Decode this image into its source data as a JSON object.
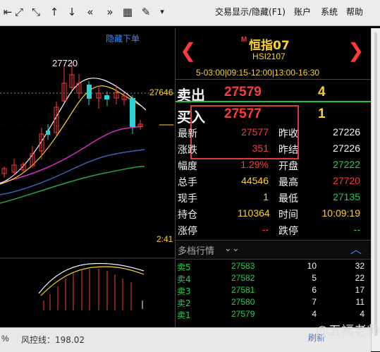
{
  "toolbar": {
    "icons": [
      "arrow-left-icon",
      "resize-icon",
      "shrink-icon",
      "up-arrow-icon",
      "down-arrow-icon",
      "double-left-icon",
      "double-right-icon",
      "grid-icon",
      "pen-icon",
      "dropdown-icon"
    ],
    "menus": [
      "交易显示/隐藏(F1)",
      "账户",
      "系统",
      "帮助"
    ]
  },
  "chart": {
    "hide_order_label": "隐藏下单",
    "high_label": "27720",
    "price_label": "27646",
    "time_label": "2:41"
  },
  "symbol": {
    "badge": "M",
    "name": "恒指07",
    "code": "HSI2107",
    "session": "5-03:00|09:15-12:00|13:00-16:30"
  },
  "order_book": {
    "ask_label": "卖出",
    "ask_price": "27579",
    "ask_volume": "4",
    "bid_label": "买入",
    "bid_price": "27577",
    "bid_volume": "1"
  },
  "quote": {
    "rows": [
      {
        "l1": "最新",
        "v1": "27577",
        "l2": "昨收",
        "v2": "27226",
        "c1": "red",
        "c2": "white"
      },
      {
        "l1": "涨跌",
        "v1": "351",
        "l2": "昨结",
        "v2": "27226",
        "c1": "red",
        "c2": "white"
      },
      {
        "l1": "幅度",
        "v1": "1.29%",
        "l2": "开盘",
        "v2": "27222",
        "c1": "red",
        "c2": "green"
      },
      {
        "l1": "总手",
        "v1": "44546",
        "l2": "最高",
        "v2": "27720",
        "c1": "yellow",
        "c2": "red"
      },
      {
        "l1": "现手",
        "v1": "1",
        "l2": "最低",
        "v2": "27135",
        "c1": "yellow",
        "c2": "green"
      },
      {
        "l1": "持仓",
        "v1": "110364",
        "l2": "时间",
        "v2": "10:09:19",
        "c1": "yellow",
        "c2": "yellow"
      },
      {
        "l1": "涨停",
        "v1": "--",
        "l2": "跌停",
        "v2": "--",
        "c1": "red",
        "c2": "green"
      }
    ]
  },
  "depth": {
    "title": "多档行情",
    "rows": [
      {
        "label": "卖5",
        "price": "27583",
        "qty": "10",
        "q2": "32"
      },
      {
        "label": "卖4",
        "price": "27582",
        "qty": "5",
        "q2": "22"
      },
      {
        "label": "卖3",
        "price": "27581",
        "qty": "6",
        "q2": "17"
      },
      {
        "label": "卖2",
        "price": "27580",
        "qty": "7",
        "q2": "11"
      },
      {
        "label": "卖1",
        "price": "27579",
        "qty": "4",
        "q2": "4"
      }
    ]
  },
  "status": {
    "left": "%",
    "risk_label": "风控线：198.02",
    "refresh": "刷新",
    "watermark": "@五福老师"
  },
  "colors": {
    "red": "#ff3b3b",
    "green": "#21d04f",
    "yellow": "#ffd321",
    "cyan": "#2bd3d3",
    "blue": "#3c8cff"
  }
}
